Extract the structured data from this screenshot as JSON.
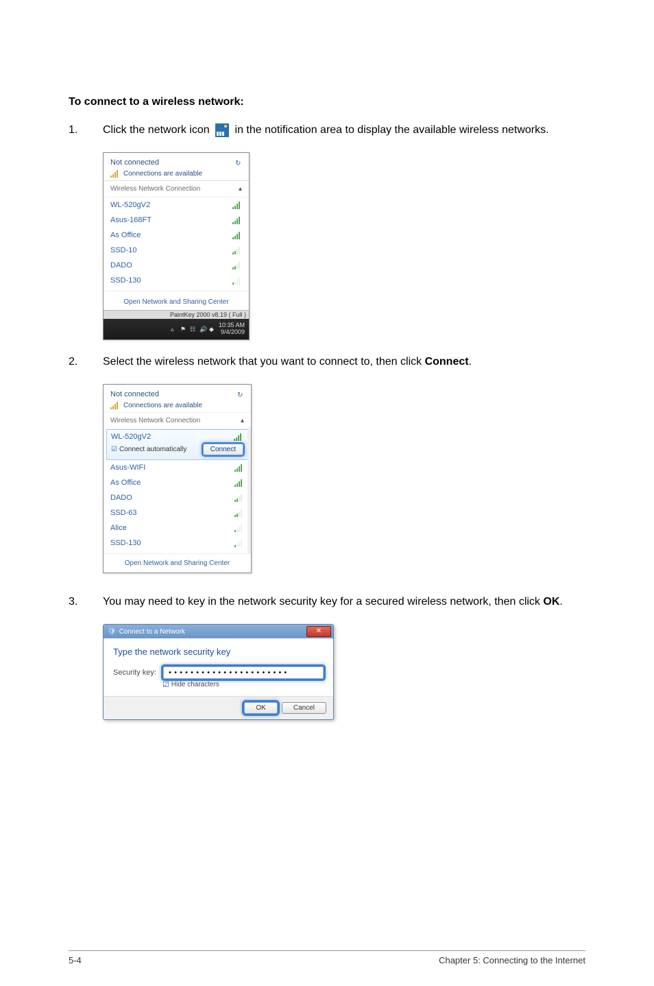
{
  "heading": "To connect to a wireless network:",
  "steps": {
    "s1_num": "1.",
    "s1_text_before": "Click the network icon ",
    "s1_text_after": " in the notification area to display the available wireless networks.",
    "s2_num": "2.",
    "s2_text_before": "Select the wireless network that you want to connect to, then click ",
    "s2_bold": "Connect",
    "s2_text_after": ".",
    "s3_num": "3.",
    "s3_text_before": "You may need to key in the network security key for a secured wireless network, then click ",
    "s3_bold": "OK",
    "s3_text_after": "."
  },
  "popup1": {
    "not_connected": "Not connected",
    "connections_available": "Connections are available",
    "section": "Wireless Network Connection",
    "networks": [
      "WL-520gV2",
      "Asus-168FT",
      "As Office",
      "SSD-10",
      "DADO",
      "SSD-130"
    ],
    "open_link": "Open Network and Sharing Center",
    "status": "PaintKey 2000  v8.19 ( Full )",
    "clock": {
      "time": "10:35 AM",
      "date": "9/4/2009"
    }
  },
  "popup2": {
    "not_connected": "Not connected",
    "connections_available": "Connections are available",
    "section": "Wireless Network Connection",
    "selected_name": "WL-520gV2",
    "connect_auto": "Connect automatically",
    "connect_btn": "Connect",
    "other_networks": [
      "Asus-WIFI",
      "As Office",
      "DADO",
      "SSD-63",
      "Alice",
      "SSD-130"
    ],
    "open_link": "Open Network and Sharing Center"
  },
  "popup3": {
    "title": "Connect to a Network",
    "prompt": "Type the network security key",
    "key_label": "Security key:",
    "key_value": "••••••••••••••••••••••",
    "hide_chars": "Hide characters",
    "ok": "OK",
    "cancel": "Cancel"
  },
  "footer": {
    "left": "5-4",
    "right": "Chapter 5: Connecting to the Internet"
  }
}
